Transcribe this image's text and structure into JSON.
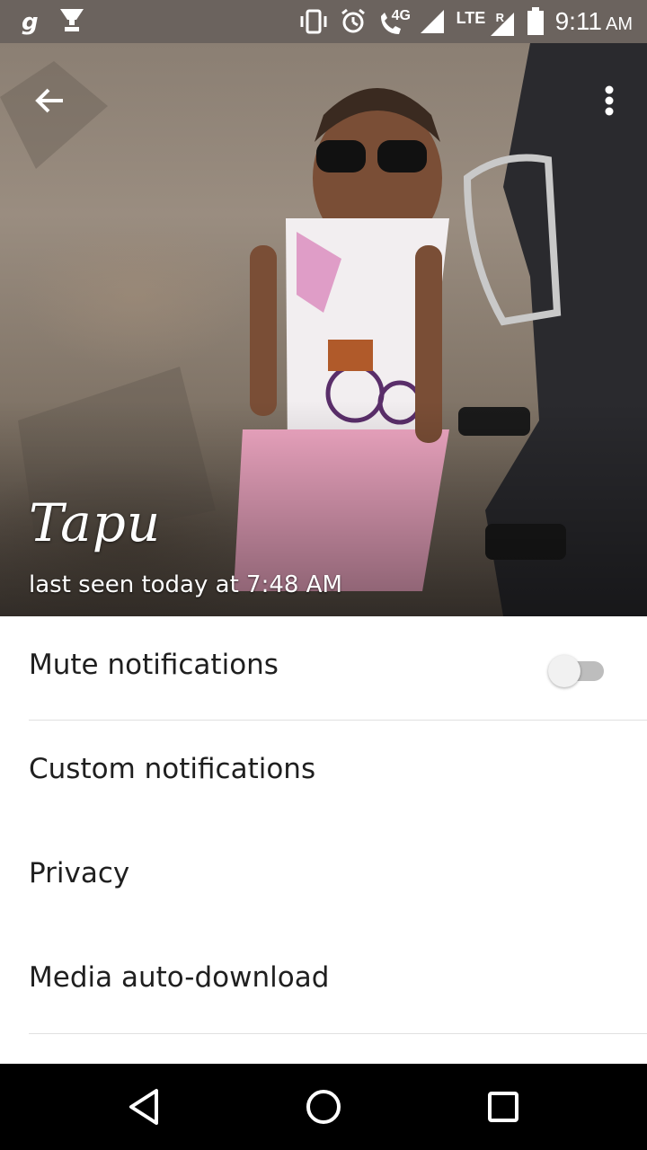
{
  "status_bar": {
    "left_icons": [
      "g-logo-icon",
      "trophy-icon"
    ],
    "right_icons": [
      "vibrate-icon",
      "alarm-icon",
      "volte-call-icon",
      "signal-icon",
      "lte-signal-icon",
      "battery-icon"
    ],
    "network_4g": "4G",
    "network_lte": "LTE",
    "roaming": "R",
    "time": "9:11",
    "ampm": "AM"
  },
  "header": {
    "contact_name": "Tapu",
    "last_seen": "last seen today at 7:48 AM"
  },
  "settings": {
    "items": [
      {
        "label": "Mute notifications",
        "toggle": false
      },
      {
        "label": "Custom notifications"
      },
      {
        "label": "Privacy"
      },
      {
        "label": "Media auto-download"
      }
    ]
  },
  "nav_bar": {
    "buttons": [
      "back-icon",
      "home-icon",
      "recents-icon"
    ]
  },
  "colors": {
    "status_bar": "#6b635e",
    "toggle_track": "#bdbdbd",
    "toggle_thumb": "#f1f1f1",
    "divider": "#e0e0e0",
    "nav_bar": "#000000"
  }
}
